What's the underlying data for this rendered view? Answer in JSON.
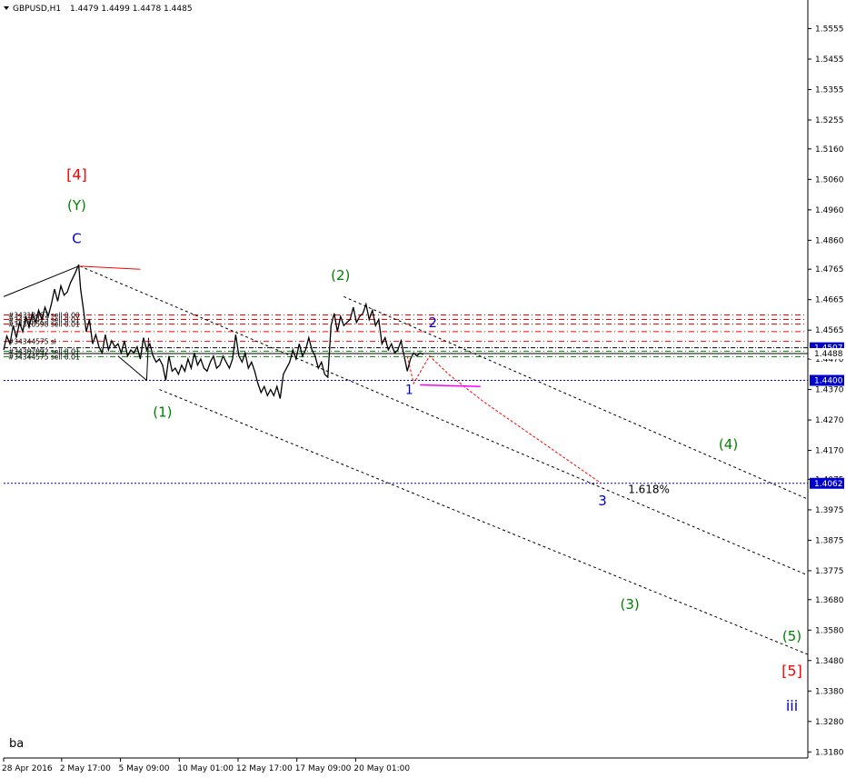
{
  "header": {
    "symbol": "GBPUSD,H1",
    "ohlc": "1.4479 1.4499 1.4478 1.4485"
  },
  "footer_label": "ba",
  "colors": {
    "price_line": "#000000",
    "axis": "#000000",
    "order_line_red": "#ff0000",
    "order_line_green": "#008000",
    "level_blue": "#0000cd",
    "projection_red": "#ff0000",
    "projection_magenta": "#ff00ff",
    "wave_red": "#ff0000",
    "wave_green": "#008000",
    "wave_blue": "#0000cd",
    "price_tag_bg": "#0000cd"
  },
  "chart_data": {
    "type": "line",
    "symbol": "GBPUSD",
    "timeframe": "H1",
    "y_ticks": [
      1.5555,
      1.5455,
      1.5355,
      1.5255,
      1.516,
      1.506,
      1.496,
      1.486,
      1.4765,
      1.4665,
      1.4565,
      1.447,
      1.437,
      1.427,
      1.417,
      1.4075,
      1.3975,
      1.3875,
      1.3775,
      1.368,
      1.358,
      1.348,
      1.338,
      1.328,
      1.318
    ],
    "ylim": [
      1.316,
      1.564
    ],
    "x_ticks": [
      {
        "label": "28 Apr 2016",
        "t": 0
      },
      {
        "label": "2 May 17:00",
        "t": 9.125
      },
      {
        "label": "5 May 09:00",
        "t": 18.375
      },
      {
        "label": "10 May 01:00",
        "t": 27.625
      },
      {
        "label": "12 May 17:00",
        "t": 36.875
      },
      {
        "label": "17 May 09:00",
        "t": 46.125
      },
      {
        "label": "20 May 01:00",
        "t": 55.375
      }
    ],
    "x_range": [
      0,
      126.5
    ],
    "price_series": [
      [
        0.0,
        1.45
      ],
      [
        0.5,
        1.4545
      ],
      [
        1.0,
        1.452
      ],
      [
        1.5,
        1.458
      ],
      [
        2.0,
        1.454
      ],
      [
        2.5,
        1.459
      ],
      [
        3.0,
        1.456
      ],
      [
        3.5,
        1.461
      ],
      [
        4.0,
        1.4575
      ],
      [
        4.5,
        1.462
      ],
      [
        5.0,
        1.459
      ],
      [
        5.5,
        1.463
      ],
      [
        6.0,
        1.46
      ],
      [
        6.5,
        1.464
      ],
      [
        7.0,
        1.461
      ],
      [
        7.5,
        1.465
      ],
      [
        8.0,
        1.47
      ],
      [
        8.5,
        1.466
      ],
      [
        9.0,
        1.471
      ],
      [
        9.5,
        1.468
      ],
      [
        10.0,
        1.469
      ],
      [
        10.5,
        1.472
      ],
      [
        11.2,
        1.475
      ],
      [
        11.8,
        1.478
      ],
      [
        12.1,
        1.47
      ],
      [
        12.5,
        1.464
      ],
      [
        13.0,
        1.456
      ],
      [
        13.5,
        1.46
      ],
      [
        14.0,
        1.452
      ],
      [
        14.5,
        1.455
      ],
      [
        15.0,
        1.451
      ],
      [
        15.5,
        1.449
      ],
      [
        16.0,
        1.455
      ],
      [
        16.5,
        1.45
      ],
      [
        17.0,
        1.453
      ],
      [
        17.5,
        1.451
      ],
      [
        18.0,
        1.452
      ],
      [
        18.5,
        1.449
      ],
      [
        19.0,
        1.453
      ],
      [
        19.5,
        1.448
      ],
      [
        20.0,
        1.45
      ],
      [
        20.5,
        1.449
      ],
      [
        21.0,
        1.451
      ],
      [
        21.5,
        1.447
      ],
      [
        22.0,
        1.454
      ],
      [
        22.5,
        1.45
      ],
      [
        23.0,
        1.452
      ],
      [
        23.5,
        1.448
      ],
      [
        24.0,
        1.446
      ],
      [
        24.5,
        1.447
      ],
      [
        25.0,
        1.445
      ],
      [
        25.5,
        1.44
      ],
      [
        26.0,
        1.448
      ],
      [
        26.5,
        1.443
      ],
      [
        27.0,
        1.444
      ],
      [
        27.5,
        1.442
      ],
      [
        28.0,
        1.445
      ],
      [
        28.5,
        1.443
      ],
      [
        29.0,
        1.447
      ],
      [
        29.5,
        1.444
      ],
      [
        30.0,
        1.449
      ],
      [
        30.5,
        1.445
      ],
      [
        31.0,
        1.447
      ],
      [
        31.5,
        1.444
      ],
      [
        32.0,
        1.443
      ],
      [
        32.5,
        1.446
      ],
      [
        33.0,
        1.448
      ],
      [
        33.5,
        1.444
      ],
      [
        34.0,
        1.445
      ],
      [
        34.5,
        1.448
      ],
      [
        35.0,
        1.446
      ],
      [
        35.5,
        1.444
      ],
      [
        36.0,
        1.447
      ],
      [
        36.5,
        1.455
      ],
      [
        37.0,
        1.448
      ],
      [
        37.5,
        1.446
      ],
      [
        38.0,
        1.449
      ],
      [
        38.5,
        1.444
      ],
      [
        39.0,
        1.446
      ],
      [
        39.5,
        1.443
      ],
      [
        40.0,
        1.439
      ],
      [
        40.5,
        1.436
      ],
      [
        41.0,
        1.438
      ],
      [
        41.5,
        1.435
      ],
      [
        42.0,
        1.437
      ],
      [
        42.5,
        1.435
      ],
      [
        43.0,
        1.438
      ],
      [
        43.5,
        1.434
      ],
      [
        44.0,
        1.442
      ],
      [
        44.5,
        1.444
      ],
      [
        45.0,
        1.446
      ],
      [
        45.5,
        1.45
      ],
      [
        46.0,
        1.447
      ],
      [
        46.5,
        1.452
      ],
      [
        47.0,
        1.448
      ],
      [
        47.5,
        1.45
      ],
      [
        48.0,
        1.454
      ],
      [
        48.5,
        1.45
      ],
      [
        49.0,
        1.448
      ],
      [
        49.5,
        1.444
      ],
      [
        50.0,
        1.446
      ],
      [
        50.5,
        1.442
      ],
      [
        51.0,
        1.441
      ],
      [
        51.5,
        1.458
      ],
      [
        52.0,
        1.462
      ],
      [
        52.5,
        1.456
      ],
      [
        53.0,
        1.461
      ],
      [
        53.5,
        1.458
      ],
      [
        54.0,
        1.459
      ],
      [
        54.5,
        1.46
      ],
      [
        55.0,
        1.464
      ],
      [
        55.5,
        1.459
      ],
      [
        56.0,
        1.461
      ],
      [
        56.5,
        1.462
      ],
      [
        57.0,
        1.465
      ],
      [
        57.5,
        1.46
      ],
      [
        58.0,
        1.463
      ],
      [
        58.5,
        1.458
      ],
      [
        59.0,
        1.46
      ],
      [
        59.5,
        1.452
      ],
      [
        60.0,
        1.454
      ],
      [
        60.5,
        1.45
      ],
      [
        61.0,
        1.452
      ],
      [
        61.5,
        1.449
      ],
      [
        62.0,
        1.45
      ],
      [
        62.5,
        1.453
      ],
      [
        63.0,
        1.448
      ],
      [
        63.5,
        1.443
      ],
      [
        64.0,
        1.447
      ],
      [
        64.5,
        1.449
      ],
      [
        65.0,
        1.448
      ],
      [
        65.5,
        1.449
      ],
      [
        66.0,
        1.4485
      ]
    ],
    "price_levels": [
      {
        "value": 1.4507,
        "label": "1.4507",
        "style": "dash-dot",
        "color": "#000000",
        "tag": "filled"
      },
      {
        "value": 1.4488,
        "label": "1.4488",
        "style": "solid",
        "color": "#000000",
        "tag": "plain"
      },
      {
        "value": 1.44,
        "label": "1.4400",
        "style": "dotted",
        "color": "#0000cd",
        "tag": "filled"
      },
      {
        "value": 1.4062,
        "label": "1.4062",
        "style": "dotted",
        "color": "#0000cd",
        "tag": "filled"
      }
    ],
    "order_lines": [
      {
        "value": 1.4615,
        "label": "#34318487 sell 0.00",
        "color": "#ff0000"
      },
      {
        "value": 1.46,
        "label": "#34318423 sell 0.01",
        "color": "#ff0000"
      },
      {
        "value": 1.4585,
        "label": "#34316598 sell 0.01",
        "color": "#ff0000"
      },
      {
        "value": 1.456,
        "label": "",
        "color": "#ff0000"
      },
      {
        "value": 1.4528,
        "label": "#34344575 sl",
        "color": "#ff0000"
      },
      {
        "value": 1.4496,
        "label": "#34387892 sell 0.01",
        "color": "#008000"
      },
      {
        "value": 1.4478,
        "label": "#34344575 sell 0.01",
        "color": "#008000"
      }
    ],
    "channel_lines": [
      {
        "from": [
          12.0,
          1.4775
        ],
        "to": [
          126.5,
          1.376
        ]
      },
      {
        "from": [
          24.5,
          1.437
        ],
        "to": [
          126.5,
          1.35
        ]
      },
      {
        "from": [
          53.5,
          1.4675
        ],
        "to": [
          126.5,
          1.401
        ]
      }
    ],
    "wave_lines": [
      {
        "from": [
          0.0,
          1.4675
        ],
        "to": [
          11.8,
          1.4775
        ],
        "color": "#000000"
      },
      {
        "from": [
          11.8,
          1.4775
        ],
        "to": [
          21.5,
          1.4765
        ],
        "color": "#ff0000"
      },
      {
        "from": [
          18.0,
          1.448
        ],
        "to": [
          22.5,
          1.44
        ],
        "color": "#000000"
      },
      {
        "from": [
          22.5,
          1.44
        ],
        "to": [
          22.8,
          1.454
        ],
        "color": "#000000"
      }
    ],
    "projection_path": [
      [
        63.5,
        1.448
      ],
      [
        64.5,
        1.439
      ],
      [
        67.0,
        1.448
      ],
      [
        70.0,
        1.442
      ],
      [
        75.5,
        1.433
      ],
      [
        94.0,
        1.4062
      ]
    ],
    "projection_segment": [
      [
        65.5,
        1.4385
      ],
      [
        75.0,
        1.438
      ]
    ],
    "annotations": [
      {
        "text": "[4]",
        "t": 11.5,
        "price": 1.506,
        "color": "#ff0000",
        "size": 16
      },
      {
        "text": "(Y)",
        "t": 11.5,
        "price": 1.496,
        "color": "#008000",
        "size": 15
      },
      {
        "text": "C",
        "t": 11.5,
        "price": 1.485,
        "color": "#0000cd",
        "size": 15
      },
      {
        "text": "(2)",
        "t": 53.0,
        "price": 1.473,
        "color": "#008000",
        "size": 15
      },
      {
        "text": "2",
        "t": 67.5,
        "price": 1.4575,
        "color": "#0000cd",
        "size": 15
      },
      {
        "text": "1",
        "t": 63.8,
        "price": 1.4355,
        "color": "#0000cd",
        "size": 14
      },
      {
        "text": "(1)",
        "t": 25.0,
        "price": 1.428,
        "color": "#008000",
        "size": 15
      },
      {
        "text": "(4)",
        "t": 114.0,
        "price": 1.4175,
        "color": "#008000",
        "size": 15
      },
      {
        "text": "3",
        "t": 94.2,
        "price": 1.399,
        "color": "#0000cd",
        "size": 15
      },
      {
        "text": "1.618%",
        "t": 101.5,
        "price": 1.403,
        "color": "#000000",
        "size": 12
      },
      {
        "text": "(3)",
        "t": 98.5,
        "price": 1.365,
        "color": "#008000",
        "size": 15
      },
      {
        "text": "(5)",
        "t": 124.0,
        "price": 1.3545,
        "color": "#008000",
        "size": 15
      },
      {
        "text": "[5]",
        "t": 124.0,
        "price": 1.343,
        "color": "#ff0000",
        "size": 16
      },
      {
        "text": "iii",
        "t": 124.0,
        "price": 1.3315,
        "color": "#0000cd",
        "size": 16
      }
    ]
  }
}
